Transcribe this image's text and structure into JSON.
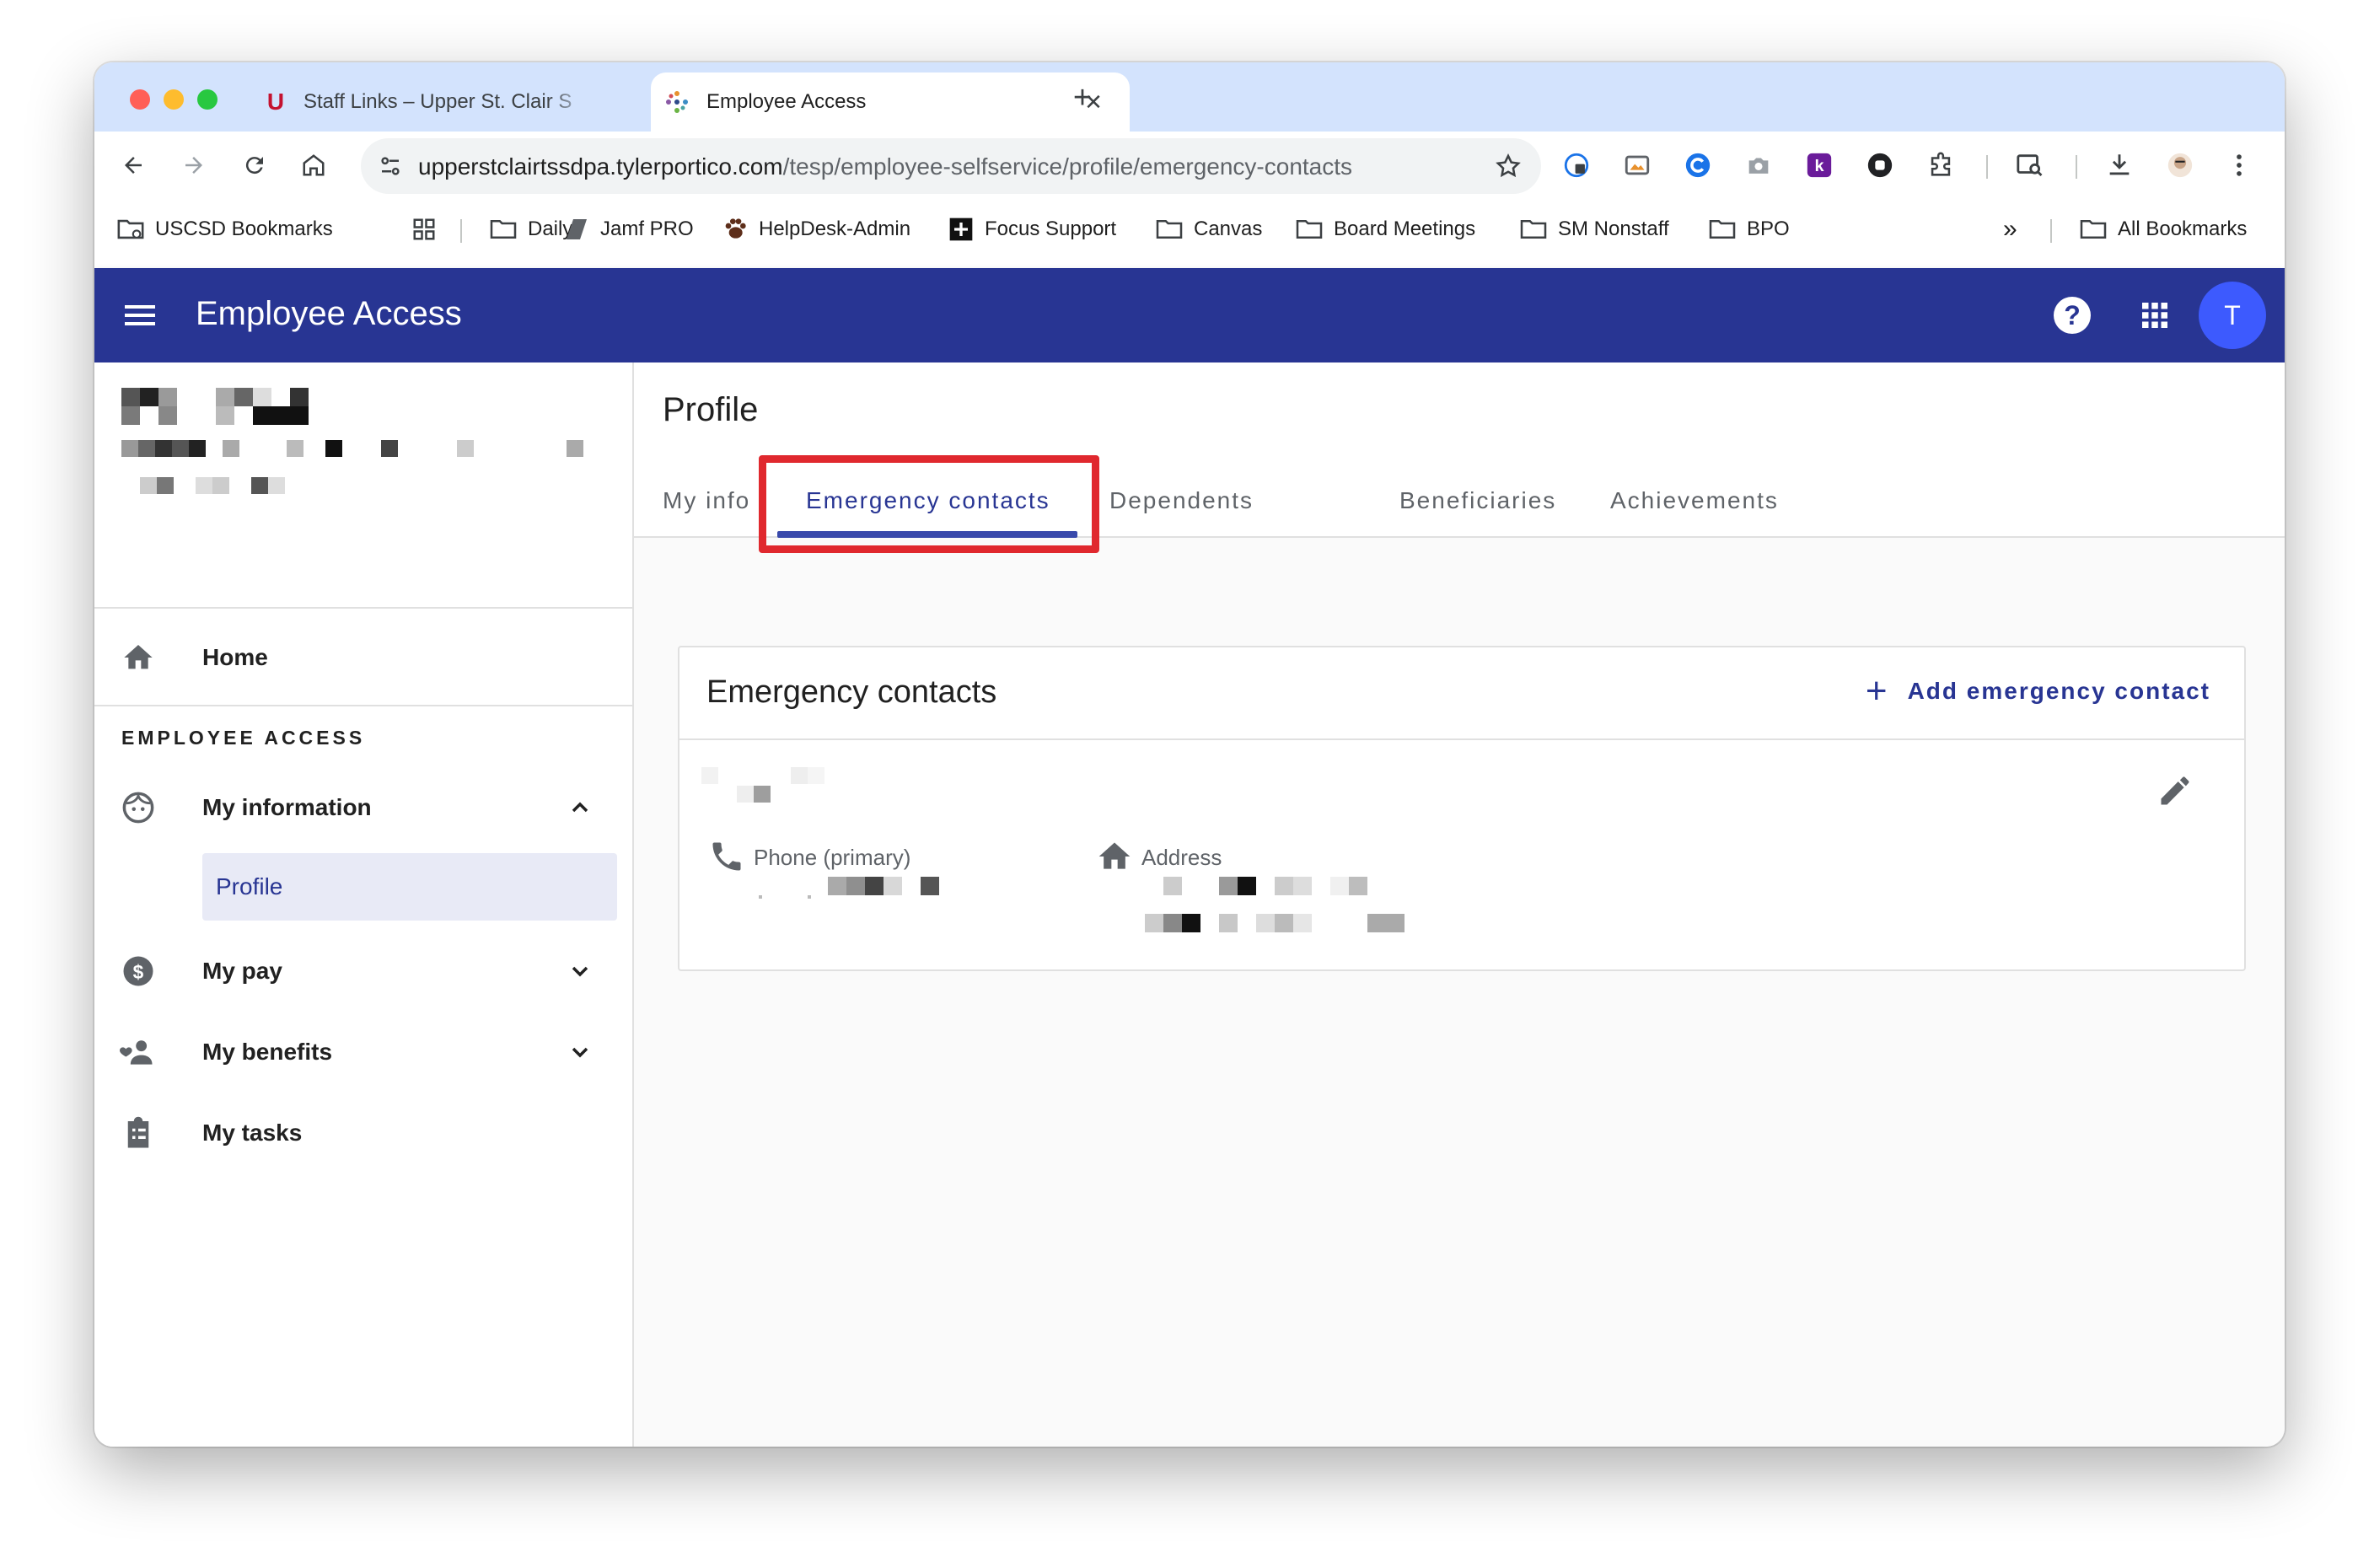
{
  "browser": {
    "tabs": [
      {
        "title": "Staff Links – Upper St. Clair S",
        "active": false
      },
      {
        "title": "Employee Access",
        "active": true
      }
    ],
    "new_tab_label": "+",
    "url": {
      "host": "upperstclairtssdpa.tylerportico.com",
      "path": "/tesp/employee-selfservice/profile/emergency-contacts"
    },
    "bookmarks": [
      {
        "label": "USCSD Bookmarks",
        "icon": "folder-link-icon"
      },
      {
        "label": "",
        "icon": "grid-icon"
      },
      {
        "label": "Daily",
        "icon": "folder-icon"
      },
      {
        "label": "Jamf PRO",
        "icon": "jamf-icon"
      },
      {
        "label": "HelpDesk-Admin",
        "icon": "paw-icon"
      },
      {
        "label": "Focus Support",
        "icon": "plus-box-icon"
      },
      {
        "label": "Canvas",
        "icon": "folder-icon"
      },
      {
        "label": "Board Meetings",
        "icon": "folder-icon"
      },
      {
        "label": "SM Nonstaff",
        "icon": "folder-icon"
      },
      {
        "label": "BPO",
        "icon": "folder-icon"
      }
    ],
    "bookmarks_overflow": "»",
    "all_bookmarks": "All Bookmarks"
  },
  "app": {
    "title": "Employee Access",
    "help_label": "?",
    "avatar_initial": "T",
    "accent": "#283593"
  },
  "sidebar": {
    "home_label": "Home",
    "section_label": "EMPLOYEE ACCESS",
    "items": [
      {
        "label": "My information",
        "icon": "face-icon",
        "expanded": true
      },
      {
        "label": "My pay",
        "icon": "dollar-circle-icon",
        "expanded": false
      },
      {
        "label": "My benefits",
        "icon": "people-icon",
        "expanded": false
      },
      {
        "label": "My tasks",
        "icon": "clipboard-icon",
        "expanded": false
      }
    ],
    "sub_item_active": "Profile"
  },
  "main": {
    "page_title": "Profile",
    "tabs": [
      {
        "label": "My info",
        "active": false
      },
      {
        "label": "Emergency contacts",
        "active": true
      },
      {
        "label": "Dependents",
        "active": false
      },
      {
        "label": "Beneficiaries",
        "active": false
      },
      {
        "label": "Achievements",
        "active": false
      }
    ],
    "card": {
      "title": "Emergency contacts",
      "add_label": "Add emergency contact",
      "phone_label": "Phone (primary)",
      "address_label": "Address"
    }
  },
  "colors": {
    "highlight": "#e0282e",
    "tab_strip": "#d3e3fd"
  }
}
